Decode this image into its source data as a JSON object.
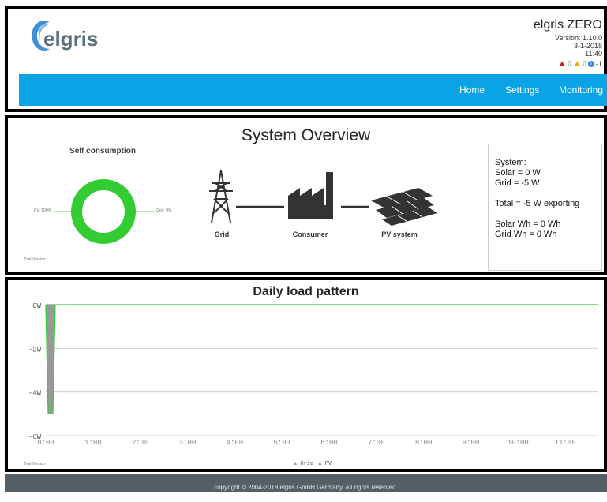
{
  "header": {
    "logo_text": "elgris",
    "app_title": "elgris ZERO",
    "version": "Version: 1.10.0",
    "date": "3-1-2018",
    "time": "11:40",
    "alerts": {
      "red_count": "0",
      "yellow_count": "0",
      "info_count": "-1"
    },
    "nav": [
      "Home",
      "Settings",
      "Monitoring"
    ],
    "colors": {
      "navbar": "#0aa3e6",
      "logo_icon": "#2a86d6"
    }
  },
  "overview": {
    "title": "System Overview",
    "self_consumption_title": "Self consumption",
    "pv_label": "PV: 100%",
    "grid_label": "Grid: 0%",
    "trial": "Trial Version",
    "self_consumption_pv_percent": 100,
    "donut_color": "#33cc33",
    "diagram_labels": {
      "grid": "Grid",
      "consumer": "Consumer",
      "pv": "PV system"
    },
    "system_box": {
      "heading": "System:",
      "solar": "Solar = 0 W",
      "grid": "Grid = -5 W",
      "total": "Total = -5 W exporting",
      "solar_wh": "Solar Wh = 0 Wh",
      "grid_wh": "Grid Wh = 0 Wh"
    }
  },
  "load_chart": {
    "title": "Daily load pattern",
    "trial": "Trial Version",
    "legend": {
      "grid": "Grid",
      "pv": "PV"
    }
  },
  "chart_data": {
    "type": "area",
    "title": "Daily load pattern",
    "x_ticks": [
      "0:00",
      "1:00",
      "2:00",
      "3:00",
      "4:00",
      "5:00",
      "6:00",
      "7:00",
      "8:00",
      "9:00",
      "10:00",
      "11:00"
    ],
    "y_ticks": [
      "0W",
      "-2W",
      "-4W",
      "-6W"
    ],
    "ylim": [
      -6,
      0
    ],
    "xlim_hours": [
      0,
      11.7
    ],
    "grid": true,
    "legend_position": "bottom",
    "series": [
      {
        "name": "Grid",
        "color": "#999999",
        "points": [
          [
            0.0,
            0
          ],
          [
            0.05,
            -5
          ],
          [
            0.15,
            -5
          ],
          [
            0.2,
            0
          ]
        ]
      },
      {
        "name": "PV",
        "color": "#33cc33",
        "points": [
          [
            0.0,
            0
          ],
          [
            0.05,
            -5
          ],
          [
            0.15,
            -5
          ],
          [
            0.2,
            0
          ],
          [
            11.7,
            0
          ]
        ]
      }
    ]
  },
  "footer": {
    "copyright": "copyright © 2004-2018 elgris GmbH Germany. All rights reserved."
  }
}
